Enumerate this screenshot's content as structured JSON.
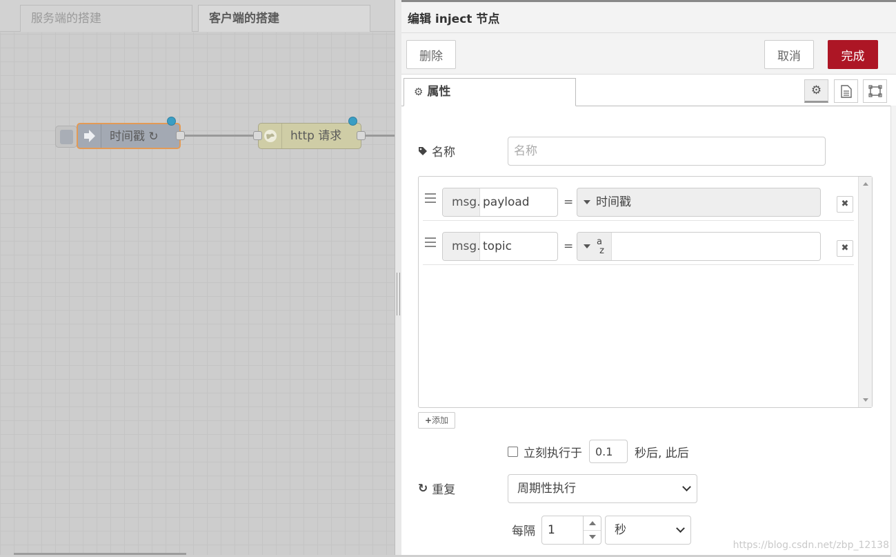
{
  "workspace": {
    "tabs": [
      {
        "label": "服务端的搭建"
      },
      {
        "label": "客户端的搭建"
      }
    ],
    "nodes": {
      "inject": {
        "label": "时间戳 ↻"
      },
      "http": {
        "label": "http 请求"
      }
    }
  },
  "editor": {
    "title": "编辑 inject 节点",
    "delete_label": "删除",
    "cancel_label": "取消",
    "done_label": "完成",
    "properties_tab": "属性",
    "name_label": "名称",
    "name_placeholder": "名称",
    "props": [
      {
        "prefix": "msg.",
        "field": "payload",
        "eq": "=",
        "type": "时间戳"
      },
      {
        "prefix": "msg.",
        "field": "topic",
        "eq": "=",
        "type_icon": "a z"
      }
    ],
    "add_label": "添加",
    "once_label": "立刻执行于",
    "once_delay": "0.1",
    "once_suffix": "秒后, 此后",
    "repeat_label": "重复",
    "repeat_value": "周期性执行",
    "interval_label": "每隔",
    "interval_value": "1",
    "interval_unit": "秒"
  },
  "watermark": "https://blog.csdn.net/zbp_12138",
  "colors": {
    "done_button": "#ad1625",
    "inject_node": "#a3a9b3",
    "inject_selected_border": "#e39a55",
    "http_node": "#cfcda6",
    "status_dot": "#3a9ec4"
  }
}
